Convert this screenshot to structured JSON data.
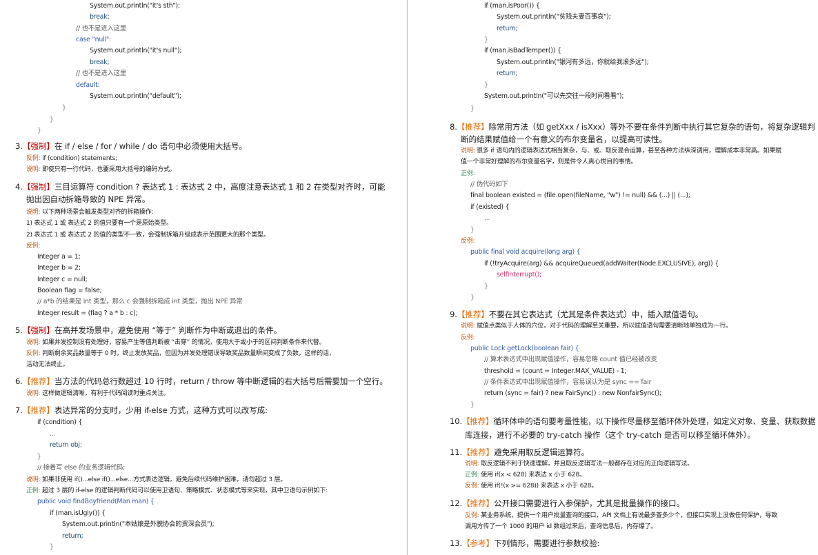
{
  "left": {
    "code_top": {
      "l1": "System.out.println(\"it's sth\");",
      "l2": "break;",
      "l3": "// 也不是进入这里",
      "l4": "case \"null\":",
      "l5": "System.out.println(\"it's null\");",
      "l6": "break;",
      "l7": "// 也不是进入这里",
      "l8": "default:",
      "l9": "System.out.println(\"default\");",
      "l10": "}",
      "l11": "}",
      "l12": "}"
    },
    "r3": {
      "head_num": "3.",
      "head_tag": "【强制】",
      "head_text": "在 if / else / for / while / do 语句中必须使用大括号。",
      "l1_label": "反例:",
      "l1_text": " if (condition) statements;",
      "l2_label": "说明:",
      "l2_text": " 即使只有一行代码，也要采用大括号的编码方式。"
    },
    "r4": {
      "head_num": "4.",
      "head_tag": "【强制】",
      "head_text": "三目运算符 condition ? 表达式 1 : 表达式 2 中，高度注意表达式 1 和 2 在类型对齐时，可能",
      "head_text2": "抛出因自动拆箱导致的 NPE 异常。",
      "l1_label": "说明:",
      "l1_text": " 以下两种场景会触发类型对齐的拆箱操作:",
      "l2": "1) 表达式 1 或 表达式 2 的值只要有一个是原始类型。",
      "l3": "2) 表达式 1 或 表达式 2 的值的类型不一致，会强制拆箱升级成表示范围更大的那个类型。",
      "l4_label": "反例:",
      "c1": "Integer a = 1;",
      "c2": "Integer b = 2;",
      "c3": "Integer c = null;",
      "c4": "Boolean flag = false;",
      "c5": "// a*b 的结果是 int 类型，那么 c 会强制拆箱成 int 类型，抛出 NPE 异常",
      "c6": "Integer result = (flag ? a * b : c);"
    },
    "r5": {
      "head_num": "5.",
      "head_tag": "【强制】",
      "head_text": "在高并发场景中，避免使用 “等于” 判断作为中断或退出的条件。",
      "l1_label": "说明:",
      "l1_text": " 如果并发控制没有处理好，容易产生等值判断被 “击穿” 的情况，使用大于或小于的区间判断条件来代替。",
      "l2_label": "反例:",
      "l2_text": " 判断剩余奖品数量等于 0 时，终止发放奖品，但因为并发处理错误导致奖品数量瞬间变成了负数，这样的话，",
      "l3": "活动无法终止。"
    },
    "r6": {
      "head_num": "6.",
      "head_tag": "【推荐】",
      "head_text": "当方法的代码总行数超过 10 行时，return / throw 等中断逻辑的右大括号后需要加一个空行。",
      "l1_label": "说明:",
      "l1_text": " 这样做逻辑清晰，有利于代码阅读时重点关注。"
    },
    "r7": {
      "head_num": "7.",
      "head_tag": "【推荐】",
      "head_text": "表达异常的分支时，少用 if-else 方式，这种方式可以改写成:",
      "c1": "if (condition) {",
      "c2": "...",
      "c3": "return obj;",
      "c4": "}",
      "c5": "// 接着写 else 的业务逻辑代码;",
      "l1_label": "说明:",
      "l1_text": " 如果非使用 if()...else if()...else...方式表达逻辑，避免后续代码维护困难，请勿超过 3 层。",
      "l2_label": "正例:",
      "l2_text": " 超过 3 层的 if-else 的逻辑判断代码可以使用卫语句、策略模式、状态模式等来实现，其中卫语句示例如下:",
      "c6": "public void findBoyfriend(Man man) {",
      "c7": "if (man.isUgly()) {",
      "c8": "System.out.println(\"本姑娘是外貌协会的资深会员\");",
      "c9": "return;",
      "c10": "}"
    }
  },
  "right": {
    "code_top": {
      "l1": "if (man.isPoor()) {",
      "l2": "System.out.println(\"贫贱夫妻百事哀\");",
      "l3": "return;",
      "l4": "}",
      "l5": "if (man.isBadTemper()) {",
      "l6": "System.out.println(\"银河有多远，你就给我滚多远\");",
      "l7": "return;",
      "l8": "}",
      "l9": "System.out.println(\"可以先交往一段时间看看\");",
      "l10": "}"
    },
    "r8": {
      "head_num": "8.",
      "head_tag": "【推荐】",
      "head_text": "除常用方法（如 getXxx / isXxx）等外不要在条件判断中执行其它复杂的语句，将复杂逻辑判",
      "head_text2": "断的结果赋值给一个有意义的布尔变量名，以提高可读性。",
      "l1_label": "说明:",
      "l1_text": " 很多 if 语句内的逻辑表达式相当复杂，与、或、取反混合运算，甚至各种方法纵深调用，理解成本非常高。如果赋",
      "l2": "值一个非常好理解的布尔变量名字，则是件令人爽心悦目的事情。",
      "l3_label": "正例:",
      "c1": "// 伪代码如下",
      "c2": "final boolean existed = (file.open(fileName, \"w\") != null) && (...) || (...);",
      "c3": "if (existed) {",
      "c4": "...",
      "c5": "}",
      "l4_label": "反例:",
      "c6": "public final void acquire(long arg) {",
      "c7": "if (!tryAcquire(arg) && acquireQueued(addWaiter(Node.EXCLUSIVE), arg)) {",
      "c8": "selfInterrupt();",
      "c9": "}",
      "c10": "}"
    },
    "r9": {
      "head_num": "9.",
      "head_tag": "【推荐】",
      "head_text": "不要在其它表达式（尤其是条件表达式）中，插入赋值语句。",
      "l1_label": "说明:",
      "l1_text": " 赋值点类似于人体的穴位，对于代码的理解至关重要，所以赋值语句需要清晰地单独成为一行。",
      "l2_label": "反例:",
      "c1": "public Lock getLock(boolean fair) {",
      "c2": "// 算术表达式中出现赋值操作，容易忽略 count 值已经被改变",
      "c3": "threshold = (count = Integer.MAX_VALUE) - 1;",
      "c4": "// 条件表达式中出现赋值操作，容易误认为是 sync == fair",
      "c5": "return (sync = fair) ? new FairSync() : new NonfairSync();",
      "c6": "}"
    },
    "r10": {
      "head_num": "10.",
      "head_tag": "【推荐】",
      "head_text": "循环体中的语句要考量性能，以下操作尽量移至循环体外处理，如定义对象、变量、获取数据",
      "head_text2": "库连接，进行不必要的 try-catch 操作（这个 try-catch 是否可以移至循环体外）。"
    },
    "r11": {
      "head_num": "11.",
      "head_tag": "【推荐】",
      "head_text": "避免采用取反逻辑运算符。",
      "l1_label": "说明:",
      "l1_text": " 取反逻辑不利于快速理解，并且取反逻辑写法一般都存在对应的正向逻辑写法。",
      "l2_label": "正例:",
      "l2_text": " 使用 if(x < 628) 来表达 x 小于 628。",
      "l3_label": "反例:",
      "l3_text": " 使用 if(!(x >= 628)) 来表达 x 小于 628。"
    },
    "r12": {
      "head_num": "12.",
      "head_tag": "【推荐】",
      "head_text": "公开接口需要进行入参保护，尤其是批量操作的接口。",
      "l1_label": "反例:",
      "l1_text": " 某业务系统，提供一个用户批量查询的接口，API 文档上有说最多查多少个，但接口实现上没做任何保护，导致",
      "l2": "调用方传了一个 1000 的用户 id 数组过来后，查询信息后，内存爆了。"
    },
    "r13": {
      "head_num": "13.",
      "head_tag": "【参考】",
      "head_text": "下列情形，需要进行参数校验:"
    }
  },
  "colors": {
    "tag_mandatory": "#c00000",
    "tag_recommend": "#e36c09",
    "tag_reference": "#e36c09",
    "label": "#c55a11",
    "string": "#2e9b3a",
    "method": "#d6336c",
    "keyword": "#2f5aa8"
  }
}
